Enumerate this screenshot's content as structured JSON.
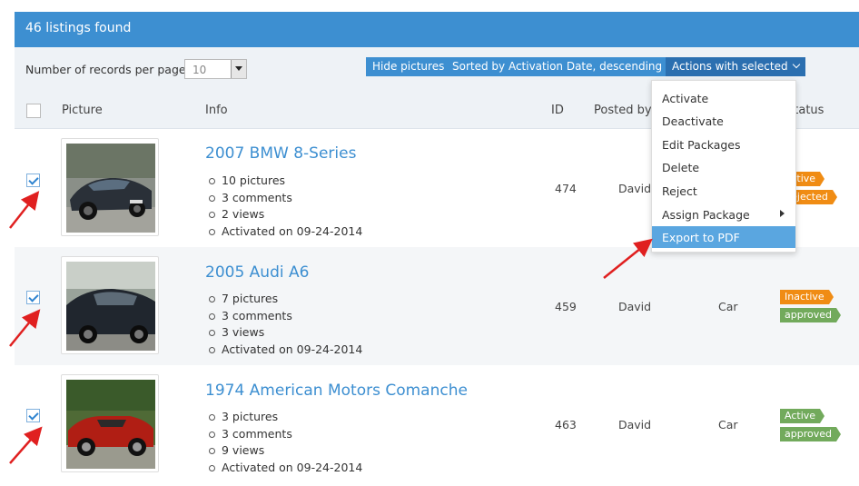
{
  "header": {
    "title": "46 listings found"
  },
  "controls": {
    "records_label": "Number of records per page",
    "records_value": "10",
    "hide_pictures": "Hide pictures",
    "sort_label": "Sorted by Activation Date, descending",
    "actions_label": "Actions with selected"
  },
  "columns": {
    "picture": "Picture",
    "info": "Info",
    "id": "ID",
    "posted_by": "Posted by",
    "status": "Status"
  },
  "dropdown": {
    "items": [
      "Activate",
      "Deactivate",
      "Edit Packages",
      "Delete",
      "Reject",
      "Assign Package",
      "Export to PDF"
    ],
    "selected": "Export to PDF"
  },
  "listings": [
    {
      "title": "2007 BMW 8-Series",
      "bullets": [
        "10 pictures",
        "3 comments",
        "2 views",
        "Activated on 09-24-2014"
      ],
      "id": "474",
      "posted_by": "David",
      "type": "",
      "badges": [
        "Active",
        "Rejected"
      ],
      "checked": true
    },
    {
      "title": "2005 Audi A6",
      "bullets": [
        "7 pictures",
        "3 comments",
        "3 views",
        "Activated on 09-24-2014"
      ],
      "id": "459",
      "posted_by": "David",
      "type": "Car",
      "badges": [
        "Inactive",
        "approved"
      ],
      "checked": true
    },
    {
      "title": "1974 American Motors Comanche",
      "bullets": [
        "3 pictures",
        "3 comments",
        "9 views",
        "Activated on 09-24-2014"
      ],
      "id": "463",
      "posted_by": "David",
      "type": "Car",
      "badges": [
        "Active",
        "approved"
      ],
      "checked": true
    }
  ],
  "colors": {
    "accent": "#3d8fd1",
    "orange": "#f08c14",
    "green": "#72aa5c",
    "arrow": "#e02020"
  }
}
